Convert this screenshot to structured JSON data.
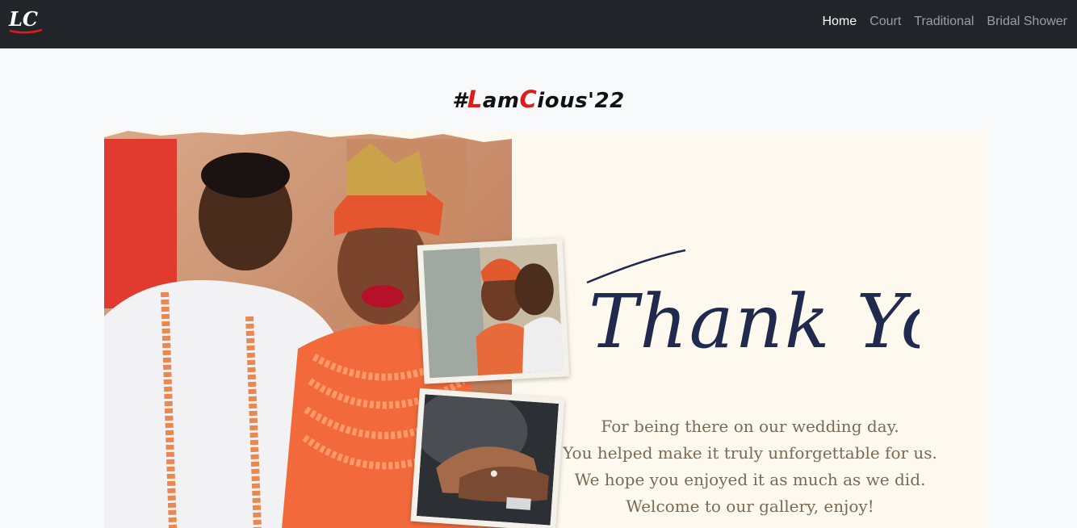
{
  "brand": {
    "logo_text": "LC",
    "icon": "lc-monogram-logo"
  },
  "nav": {
    "items": [
      {
        "label": "Home",
        "active": true
      },
      {
        "label": "Court",
        "active": false
      },
      {
        "label": "Traditional",
        "active": false
      },
      {
        "label": "Bridal Shower",
        "active": false
      }
    ]
  },
  "hero": {
    "hashtag_prefix": "#",
    "hashtag_l": "L",
    "hashtag_am": "am",
    "hashtag_c": "C",
    "hashtag_ious": "ious'22",
    "thank_you": "Thank You",
    "message_lines": [
      "For being there on our wedding day.",
      "You helped make it truly unforgettable for us.",
      "We hope you enjoyed it as much as we did.",
      "Welcome to our gallery, enjoy!"
    ]
  },
  "colors": {
    "navbar_bg": "#212529",
    "page_bg": "#f8f9fa",
    "accent_red": "#e01b1b",
    "card_bg": "#fdf9ef",
    "script_navy": "#1f2a4d",
    "message_text": "#7a6a55"
  }
}
